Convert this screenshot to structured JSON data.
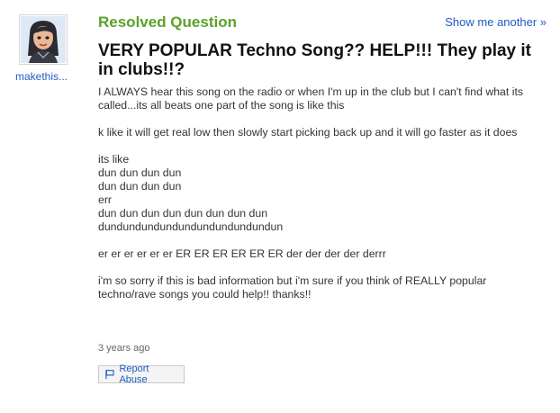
{
  "user": {
    "name": "makethis...",
    "avatar_icon": "avatar-girl-icon"
  },
  "header": {
    "status": "Resolved Question",
    "show_another": "Show me another »"
  },
  "question": {
    "title": "VERY POPULAR Techno Song?? HELP!!! They play it in clubs!!?",
    "paragraphs": [
      {
        "lines": [
          "I ALWAYS hear this song on the radio or when I'm up in the club but I can't find what its called...its all beats one part of the song is like this"
        ]
      },
      {
        "lines": [
          "k like it will get real low then slowly start picking back up and it will go faster as it does"
        ]
      },
      {
        "lines": [
          "its like",
          "dun dun dun dun",
          "dun dun dun dun",
          "err",
          "dun dun dun dun dun dun dun dun",
          "dundundundundundundundundundun"
        ]
      },
      {
        "lines": [
          "er er er er er er ER ER ER ER ER ER der der der der derrr"
        ]
      },
      {
        "lines": [
          "i'm so sorry if this is bad information but i'm sure if you think of REALLY popular techno/rave songs you could help!! thanks!!"
        ]
      }
    ],
    "timestamp": "3 years ago"
  },
  "actions": {
    "report_abuse": "Report Abuse",
    "report_icon": "flag-icon"
  },
  "colors": {
    "status_green": "#5aa228",
    "link_blue": "#1f5bc4"
  }
}
